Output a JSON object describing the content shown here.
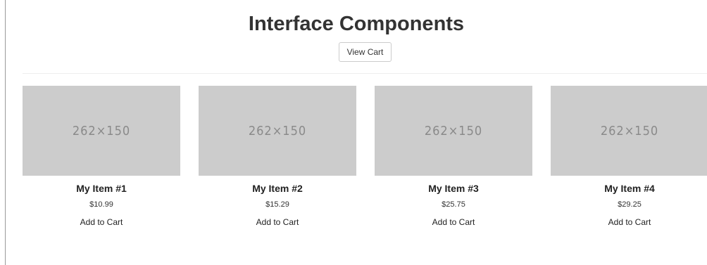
{
  "header": {
    "title": "Interface Components",
    "view_cart_label": "View Cart"
  },
  "products": [
    {
      "image_label": "262×150",
      "name": "My Item #1",
      "price": "$10.99",
      "action_label": "Add to Cart"
    },
    {
      "image_label": "262×150",
      "name": "My Item #2",
      "price": "$15.29",
      "action_label": "Add to Cart"
    },
    {
      "image_label": "262×150",
      "name": "My Item #3",
      "price": "$25.75",
      "action_label": "Add to Cart"
    },
    {
      "image_label": "262×150",
      "name": "My Item #4",
      "price": "$29.25",
      "action_label": "Add to Cart"
    }
  ],
  "colors": {
    "placeholder_bg": "#cccccc",
    "placeholder_text": "#8a8a8a",
    "text": "#333333"
  }
}
